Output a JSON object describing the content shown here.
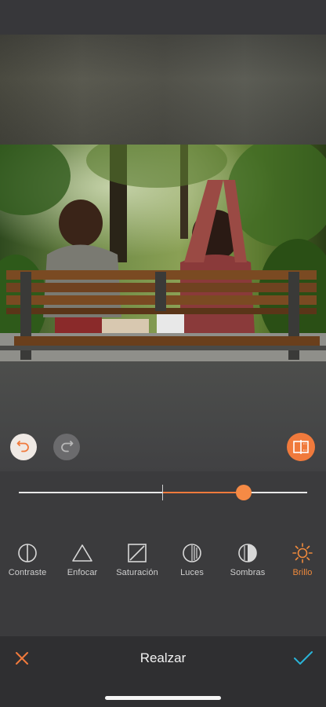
{
  "editor": {
    "title": "Realzar",
    "accent_color": "#f07a3c"
  },
  "slider": {
    "value_fraction": 0.78,
    "center_fraction": 0.5
  },
  "tools": [
    {
      "label": "Contraste",
      "icon": "contrast-icon",
      "active": false
    },
    {
      "label": "Enfocar",
      "icon": "triangle-icon",
      "active": false
    },
    {
      "label": "Saturación",
      "icon": "saturation-icon",
      "active": false
    },
    {
      "label": "Luces",
      "icon": "highlights-icon",
      "active": false
    },
    {
      "label": "Sombras",
      "icon": "shadows-icon",
      "active": false
    },
    {
      "label": "Brillo",
      "icon": "sun-icon",
      "active": true
    }
  ],
  "actions": {
    "undo_enabled": true,
    "redo_enabled": false
  }
}
